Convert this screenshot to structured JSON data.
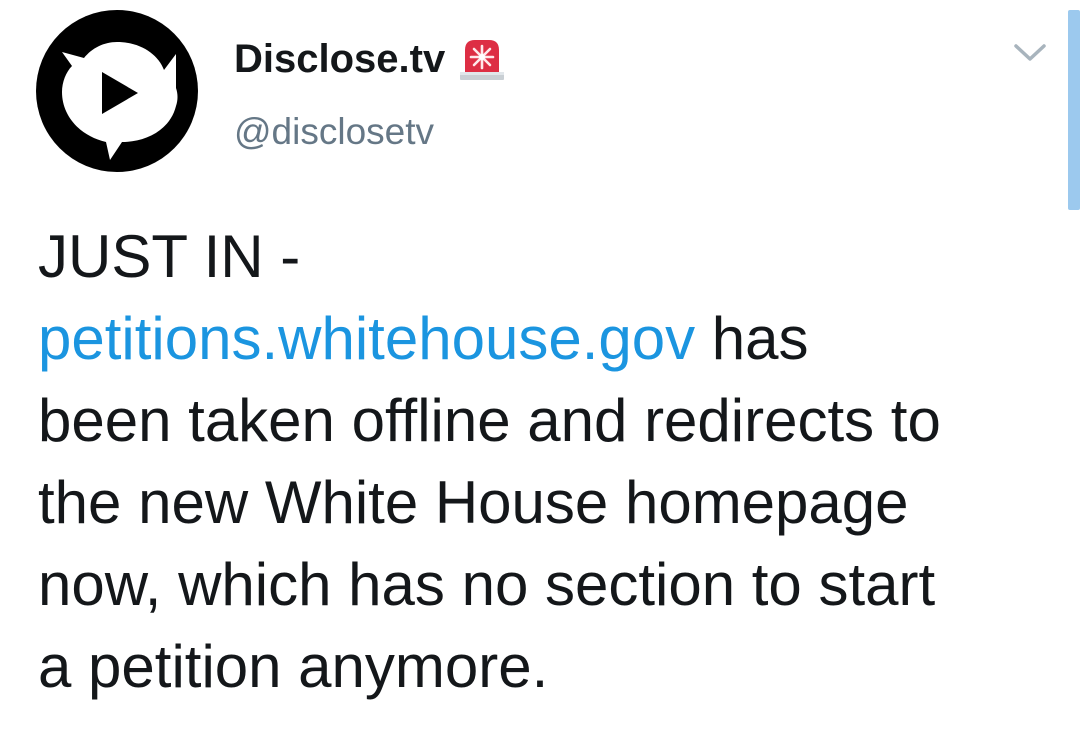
{
  "account": {
    "display_name": "Disclose.tv",
    "handle": "@disclosetv",
    "badge_icon": "police-car-light-icon",
    "avatar_icon": "play-speech-bubble-icon"
  },
  "menu": {
    "icon": "chevron-down-icon"
  },
  "tweet": {
    "line1": "JUST IN -",
    "link_text": "petitions.whitehouse.gov",
    "line2_rest": " has",
    "line3": "been taken offline and redirects to",
    "line4": "the new White House homepage",
    "line5": "now, which has no section to start",
    "line6": "a petition anymore."
  },
  "colors": {
    "link": "#1b95e0",
    "text": "#14171a",
    "secondary": "#657786",
    "scroll_indicator": "#9cc9ee"
  }
}
